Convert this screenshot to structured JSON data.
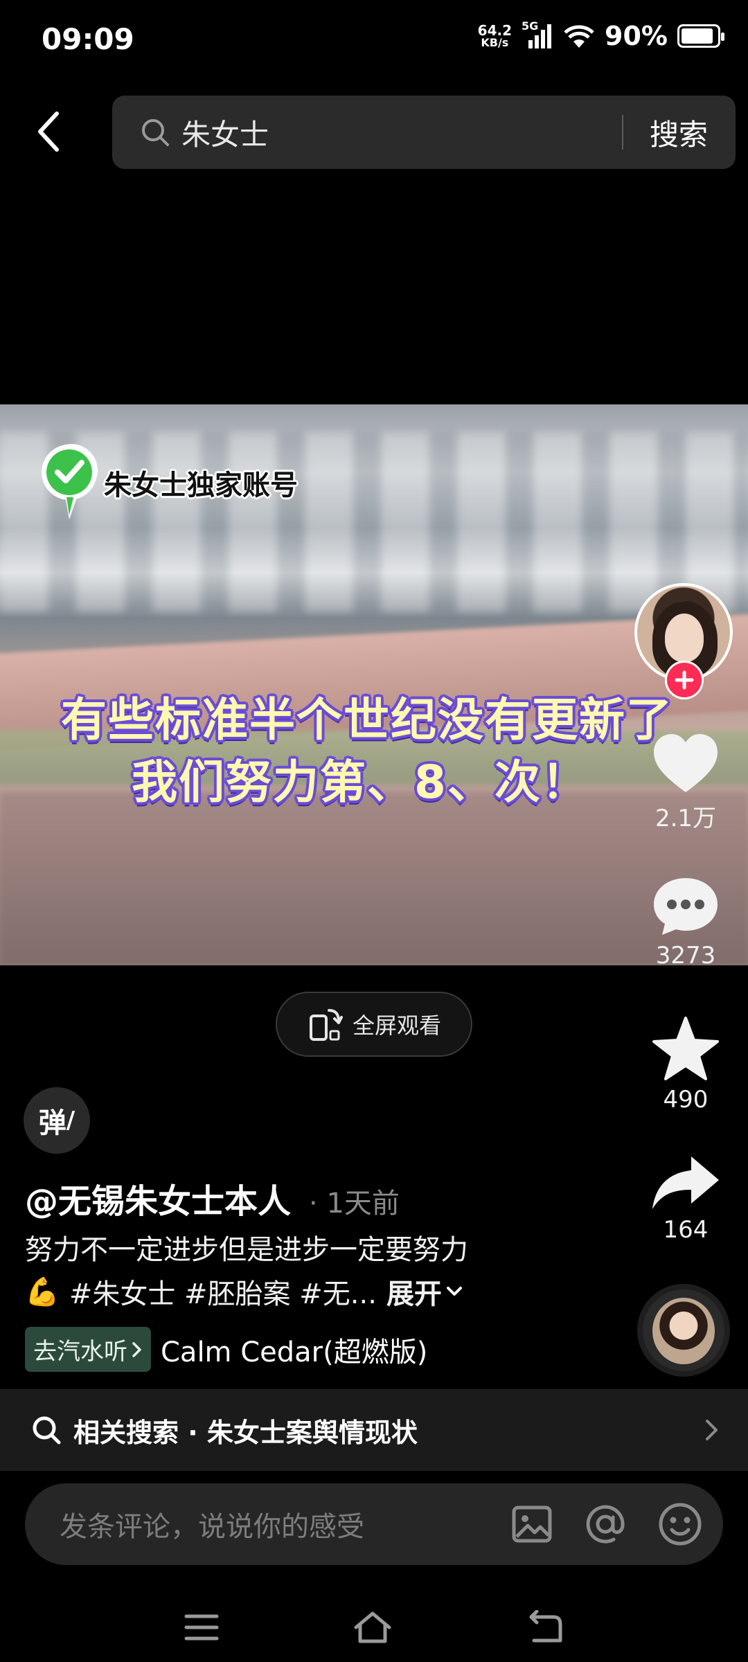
{
  "status_bar": {
    "time": "09:09",
    "net_speed_value": "64.2",
    "net_speed_unit": "KB/s",
    "network_type": "5G",
    "battery_percent": "90%"
  },
  "search": {
    "query": "朱女士",
    "button_label": "搜索"
  },
  "video": {
    "watermark": "朱女士独家账号",
    "caption_line1": "有些标准半个世纪没有更新了",
    "caption_line2": "我们努力第、8、次！"
  },
  "fullscreen_label": "全屏观看",
  "actions": {
    "likes": "2.1万",
    "comments": "3273",
    "favorites": "490",
    "shares": "164"
  },
  "danmaku_label": "弹",
  "post": {
    "author": "@无锡朱女士本人",
    "time": "· 1天前",
    "desc_line1": "努力不一定进步但是进步一定要努力",
    "emoji": "💪",
    "hashtags": "#朱女士 #胚胎案 #无...",
    "expand_label": "展开"
  },
  "music": {
    "tag_label": "去汽水听",
    "name": "Calm Cedar(超燃版)"
  },
  "related_search": "相关搜索 · 朱女士案舆情现状",
  "comment": {
    "placeholder": "发条评论，说说你的感受"
  },
  "colors": {
    "accent_red": "#fe2c55",
    "caption_fill": "#fff8b0",
    "caption_outline": "#6a4cd6",
    "music_tag_bg": "#2c4a3c"
  }
}
